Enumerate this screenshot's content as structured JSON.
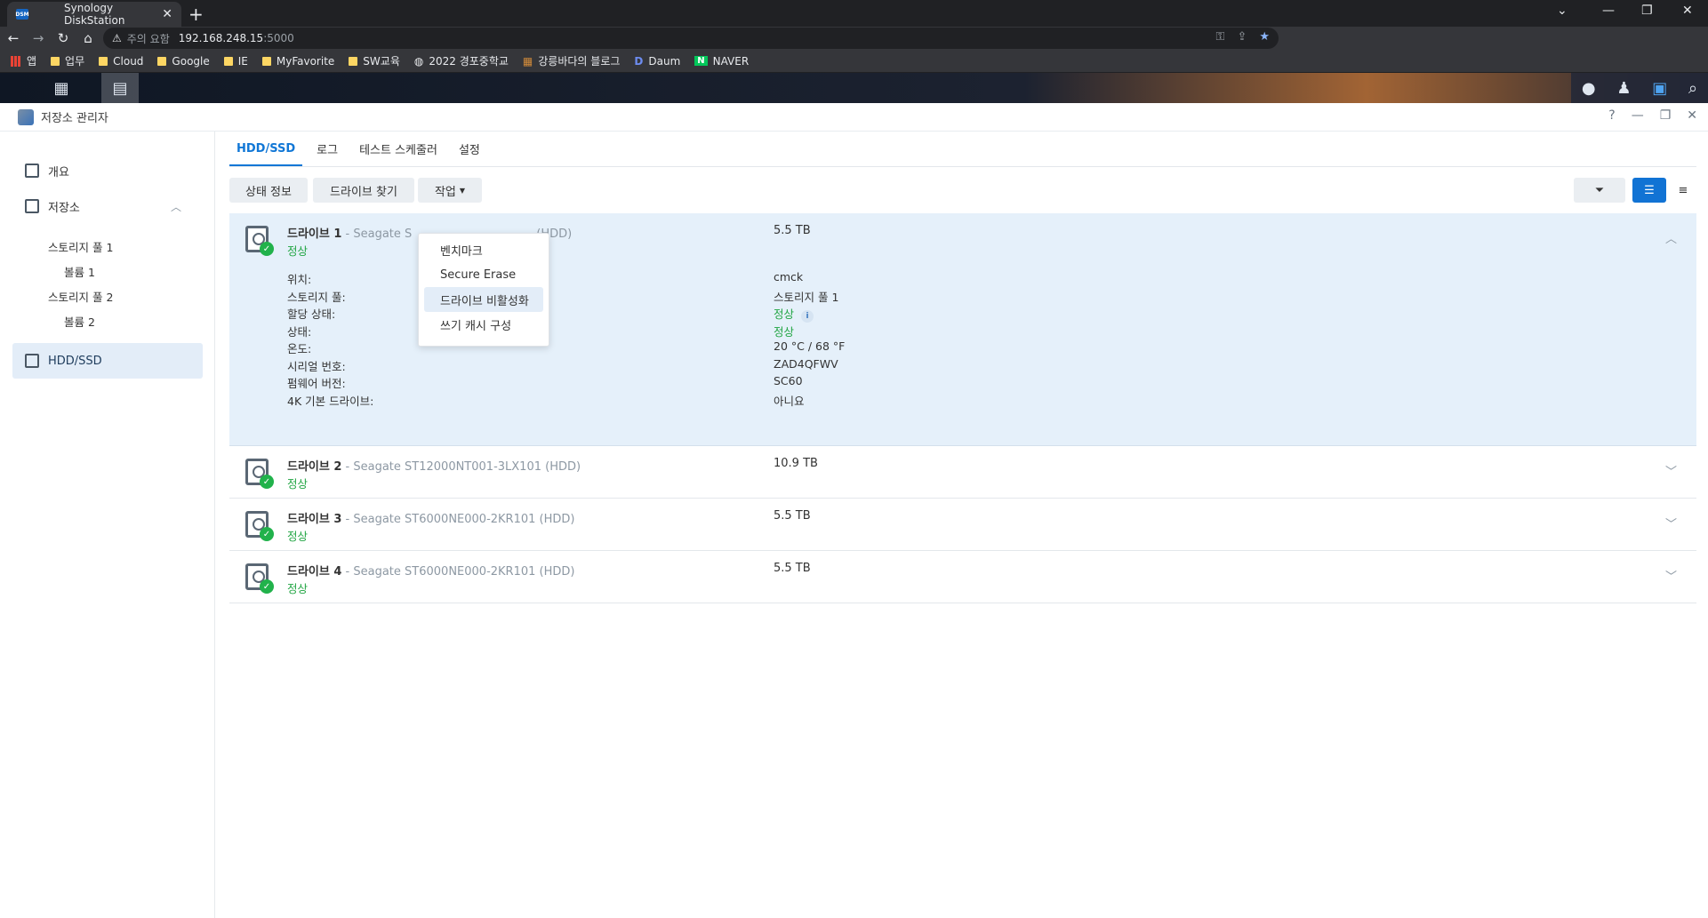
{
  "browser": {
    "tab_title": "Synology DiskStation",
    "tab_favicon": "DSM",
    "url_warning": "주의 요함",
    "url_host": "192.168.248.15",
    "url_port": ":5000",
    "bookmarks": [
      "앱",
      "업무",
      "Cloud",
      "Google",
      "IE",
      "MyFavorite",
      "SW교육",
      "2022 경포중학교",
      "강릉바다의 블로그",
      "Daum",
      "NAVER"
    ]
  },
  "window": {
    "title": "저장소 관리자"
  },
  "sidebar": {
    "overview": "개요",
    "storage": "저장소",
    "pool1": "스토리지 풀 1",
    "vol1": "볼륨 1",
    "pool2": "스토리지 풀 2",
    "vol2": "볼륨 2",
    "hdd": "HDD/SSD"
  },
  "tabs": [
    "HDD/SSD",
    "로그",
    "테스트 스케줄러",
    "설정"
  ],
  "toolbar": {
    "status_info": "상태 정보",
    "find_drive": "드라이브 찾기",
    "action": "작업"
  },
  "dropdown": [
    "벤치마크",
    "Secure Erase",
    "드라이브 비활성화",
    "쓰기 캐시 구성"
  ],
  "drives": [
    {
      "name": "드라이브 1",
      "model": " - Seagate S",
      "model_tail": "(HDD)",
      "status": "정상",
      "size": "5.5 TB"
    },
    {
      "name": "드라이브 2",
      "model": " - Seagate ST12000NT001-3LX101 (HDD)",
      "status": "정상",
      "size": "10.9 TB"
    },
    {
      "name": "드라이브 3",
      "model": " - Seagate ST6000NE000-2KR101 (HDD)",
      "status": "정상",
      "size": "5.5 TB"
    },
    {
      "name": "드라이브 4",
      "model": " - Seagate ST6000NE000-2KR101 (HDD)",
      "status": "정상",
      "size": "5.5 TB"
    }
  ],
  "details": {
    "labels": [
      "위치:",
      "스토리지 풀:",
      "할당 상태:",
      "상태:",
      "온도:",
      "시리얼 번호:",
      "펌웨어 버전:",
      "4K 기본 드라이브:"
    ],
    "values": [
      "cmck",
      "스토리지 풀 1",
      "정상",
      "정상",
      "20 °C / 68 °F",
      "ZAD4QFWV",
      "SC60",
      "아니요"
    ]
  },
  "colors": {
    "accent": "#1177d6",
    "ok": "#21a543"
  }
}
